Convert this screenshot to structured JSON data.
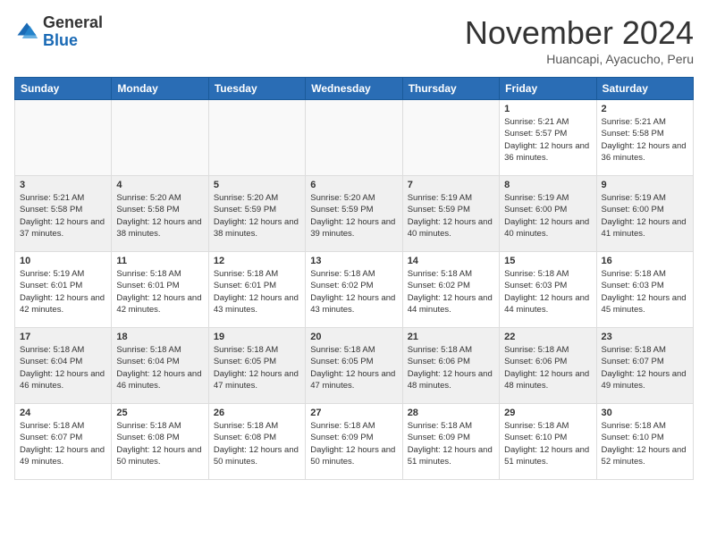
{
  "header": {
    "logo_general": "General",
    "logo_blue": "Blue",
    "month": "November 2024",
    "location": "Huancapi, Ayacucho, Peru"
  },
  "weekdays": [
    "Sunday",
    "Monday",
    "Tuesday",
    "Wednesday",
    "Thursday",
    "Friday",
    "Saturday"
  ],
  "weeks": [
    [
      {
        "day": "",
        "info": ""
      },
      {
        "day": "",
        "info": ""
      },
      {
        "day": "",
        "info": ""
      },
      {
        "day": "",
        "info": ""
      },
      {
        "day": "",
        "info": ""
      },
      {
        "day": "1",
        "info": "Sunrise: 5:21 AM\nSunset: 5:57 PM\nDaylight: 12 hours and 36 minutes."
      },
      {
        "day": "2",
        "info": "Sunrise: 5:21 AM\nSunset: 5:58 PM\nDaylight: 12 hours and 36 minutes."
      }
    ],
    [
      {
        "day": "3",
        "info": "Sunrise: 5:21 AM\nSunset: 5:58 PM\nDaylight: 12 hours and 37 minutes."
      },
      {
        "day": "4",
        "info": "Sunrise: 5:20 AM\nSunset: 5:58 PM\nDaylight: 12 hours and 38 minutes."
      },
      {
        "day": "5",
        "info": "Sunrise: 5:20 AM\nSunset: 5:59 PM\nDaylight: 12 hours and 38 minutes."
      },
      {
        "day": "6",
        "info": "Sunrise: 5:20 AM\nSunset: 5:59 PM\nDaylight: 12 hours and 39 minutes."
      },
      {
        "day": "7",
        "info": "Sunrise: 5:19 AM\nSunset: 5:59 PM\nDaylight: 12 hours and 40 minutes."
      },
      {
        "day": "8",
        "info": "Sunrise: 5:19 AM\nSunset: 6:00 PM\nDaylight: 12 hours and 40 minutes."
      },
      {
        "day": "9",
        "info": "Sunrise: 5:19 AM\nSunset: 6:00 PM\nDaylight: 12 hours and 41 minutes."
      }
    ],
    [
      {
        "day": "10",
        "info": "Sunrise: 5:19 AM\nSunset: 6:01 PM\nDaylight: 12 hours and 42 minutes."
      },
      {
        "day": "11",
        "info": "Sunrise: 5:18 AM\nSunset: 6:01 PM\nDaylight: 12 hours and 42 minutes."
      },
      {
        "day": "12",
        "info": "Sunrise: 5:18 AM\nSunset: 6:01 PM\nDaylight: 12 hours and 43 minutes."
      },
      {
        "day": "13",
        "info": "Sunrise: 5:18 AM\nSunset: 6:02 PM\nDaylight: 12 hours and 43 minutes."
      },
      {
        "day": "14",
        "info": "Sunrise: 5:18 AM\nSunset: 6:02 PM\nDaylight: 12 hours and 44 minutes."
      },
      {
        "day": "15",
        "info": "Sunrise: 5:18 AM\nSunset: 6:03 PM\nDaylight: 12 hours and 44 minutes."
      },
      {
        "day": "16",
        "info": "Sunrise: 5:18 AM\nSunset: 6:03 PM\nDaylight: 12 hours and 45 minutes."
      }
    ],
    [
      {
        "day": "17",
        "info": "Sunrise: 5:18 AM\nSunset: 6:04 PM\nDaylight: 12 hours and 46 minutes."
      },
      {
        "day": "18",
        "info": "Sunrise: 5:18 AM\nSunset: 6:04 PM\nDaylight: 12 hours and 46 minutes."
      },
      {
        "day": "19",
        "info": "Sunrise: 5:18 AM\nSunset: 6:05 PM\nDaylight: 12 hours and 47 minutes."
      },
      {
        "day": "20",
        "info": "Sunrise: 5:18 AM\nSunset: 6:05 PM\nDaylight: 12 hours and 47 minutes."
      },
      {
        "day": "21",
        "info": "Sunrise: 5:18 AM\nSunset: 6:06 PM\nDaylight: 12 hours and 48 minutes."
      },
      {
        "day": "22",
        "info": "Sunrise: 5:18 AM\nSunset: 6:06 PM\nDaylight: 12 hours and 48 minutes."
      },
      {
        "day": "23",
        "info": "Sunrise: 5:18 AM\nSunset: 6:07 PM\nDaylight: 12 hours and 49 minutes."
      }
    ],
    [
      {
        "day": "24",
        "info": "Sunrise: 5:18 AM\nSunset: 6:07 PM\nDaylight: 12 hours and 49 minutes."
      },
      {
        "day": "25",
        "info": "Sunrise: 5:18 AM\nSunset: 6:08 PM\nDaylight: 12 hours and 50 minutes."
      },
      {
        "day": "26",
        "info": "Sunrise: 5:18 AM\nSunset: 6:08 PM\nDaylight: 12 hours and 50 minutes."
      },
      {
        "day": "27",
        "info": "Sunrise: 5:18 AM\nSunset: 6:09 PM\nDaylight: 12 hours and 50 minutes."
      },
      {
        "day": "28",
        "info": "Sunrise: 5:18 AM\nSunset: 6:09 PM\nDaylight: 12 hours and 51 minutes."
      },
      {
        "day": "29",
        "info": "Sunrise: 5:18 AM\nSunset: 6:10 PM\nDaylight: 12 hours and 51 minutes."
      },
      {
        "day": "30",
        "info": "Sunrise: 5:18 AM\nSunset: 6:10 PM\nDaylight: 12 hours and 52 minutes."
      }
    ]
  ]
}
